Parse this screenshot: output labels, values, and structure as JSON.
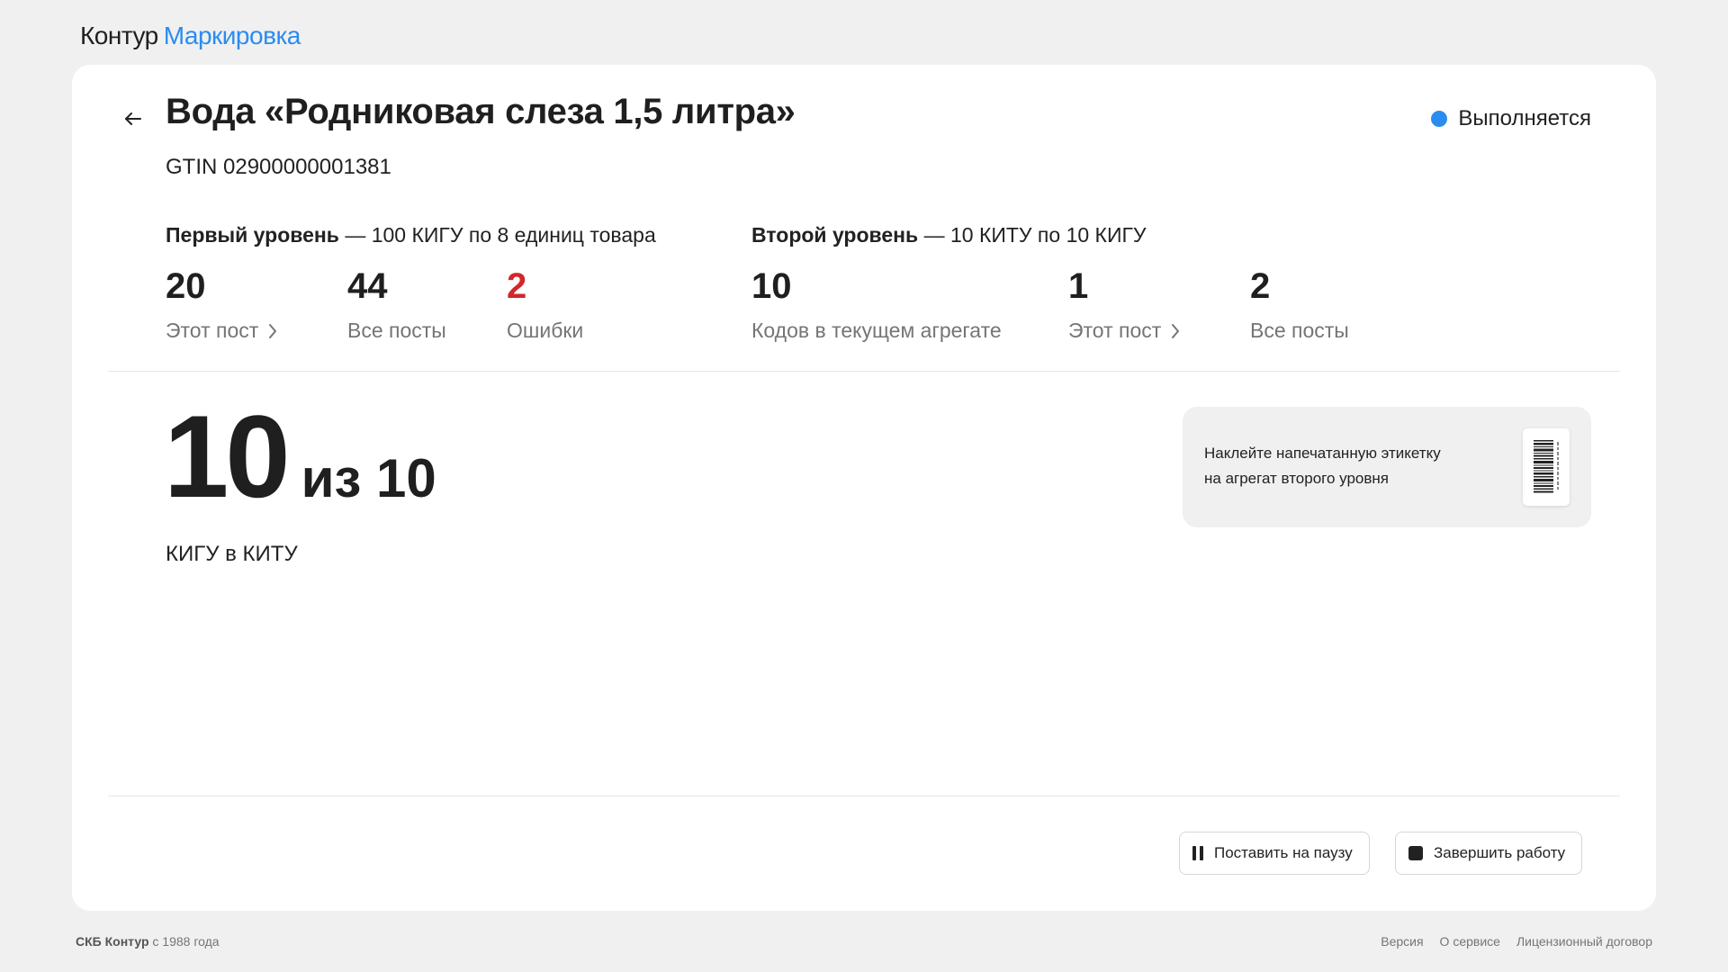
{
  "header": {
    "brand": "Контур",
    "product": "Маркировка"
  },
  "product": {
    "title": "Вода «Родниковая слеза 1,5 литра»",
    "gtin": "GTIN 02900000001381",
    "status": "Выполняется"
  },
  "levels": {
    "first": {
      "name": "Первый уровень",
      "desc": " — 100 КИГУ по 8 единиц товара",
      "stats": [
        {
          "value": "20",
          "label": "Этот пост"
        },
        {
          "value": "44",
          "label": "Все посты"
        },
        {
          "value": "2",
          "label": "Ошибки"
        }
      ]
    },
    "second": {
      "name": "Второй уровень",
      "desc": " — 10 КИТУ по 10 КИГУ",
      "stats": [
        {
          "value": "10",
          "label": "Кодов в текущем агрегате"
        },
        {
          "value": "1",
          "label": "Этот пост"
        },
        {
          "value": "2",
          "label": "Все посты"
        }
      ]
    }
  },
  "aggregate": {
    "current": "10",
    "of_total": "из 10",
    "caption": "КИГУ в КИТУ"
  },
  "hint": {
    "line1": "Наклейте напечатанную этикетку",
    "line2": "на агрегат второго уровня"
  },
  "actions": {
    "pause": "Поставить на паузу",
    "finish": "Завершить работу"
  },
  "footer": {
    "company": "СКБ Контур",
    "since": " с 1988 года",
    "links": [
      "Версия",
      "О сервисе",
      "Лицензионный договор"
    ]
  },
  "colors": {
    "accent": "#2b8cf0",
    "error": "#d0282b",
    "background": "#f0f0f0"
  }
}
